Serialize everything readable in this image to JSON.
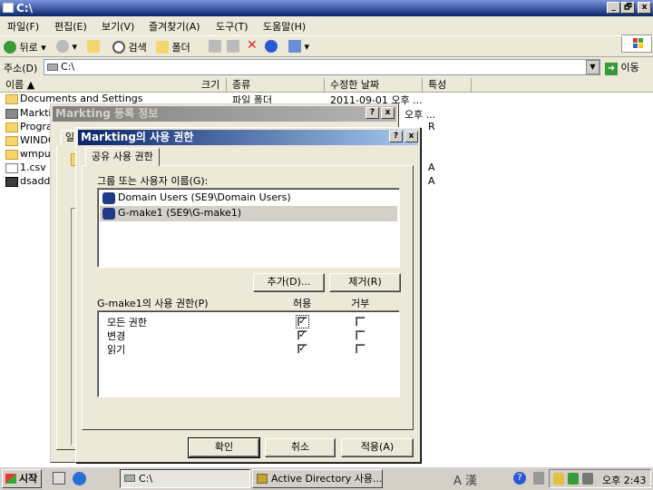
{
  "window": {
    "title": "C:\\",
    "caption_buttons": [
      "_",
      "🗗",
      "x"
    ]
  },
  "menu": [
    "파일(F)",
    "편집(E)",
    "보기(V)",
    "즐겨찾기(A)",
    "도구(T)",
    "도움말(H)"
  ],
  "toolbar": {
    "back": "뒤로",
    "search": "검색",
    "folders": "폴더"
  },
  "address": {
    "label": "주소(D)",
    "value": "C:\\",
    "go": "이동"
  },
  "columns": [
    "이름 ▲",
    "크기",
    "종류",
    "수정한 날짜",
    "특성"
  ],
  "files": [
    {
      "name": "Documents and Settings",
      "type": "파일 폴더",
      "date": "2011-09-01 오후 ...",
      "attr": ""
    },
    {
      "name": "Markti",
      "type": "",
      "date": "오후 ...",
      "attr": ""
    },
    {
      "name": "Progra",
      "type": "",
      "date": "",
      "attr": "R"
    },
    {
      "name": "WINDC",
      "type": "",
      "date": "",
      "attr": ""
    },
    {
      "name": "wmpul",
      "type": "",
      "date": "",
      "attr": ""
    },
    {
      "name": "1.csv",
      "type": "",
      "date": "",
      "attr": "A"
    },
    {
      "name": "dsadd",
      "type": "",
      "date": "",
      "attr": "A"
    }
  ],
  "prop_dialog": {
    "title": "Markting 등록 정보",
    "help": "?",
    "close": "x",
    "tab_fragment": "일"
  },
  "perm_dialog": {
    "title": "Markting의 사용 권한",
    "help": "?",
    "close": "x",
    "tab": "공유 사용 권한",
    "group_label": "그룹 또는 사용자 이름(G):",
    "users": [
      "Domain Users (SE9\\Domain Users)",
      "G-make1 (SE9\\G-make1)"
    ],
    "add_button": "추가(D)...",
    "remove_button": "제거(R)",
    "perm_label": "G-make1의 사용 권한(P)",
    "allow_header": "허용",
    "deny_header": "거부",
    "permissions": [
      {
        "name": "모든 권한",
        "allow": true,
        "deny": false
      },
      {
        "name": "변경",
        "allow": true,
        "deny": false
      },
      {
        "name": "읽기",
        "allow": true,
        "deny": false
      }
    ],
    "check_glyph": "✓",
    "ok_button": "확인",
    "cancel_button": "취소",
    "apply_button": "적용(A)"
  },
  "taskbar": {
    "start": "시작",
    "tasks": [
      "C:\\",
      "Active Directory 사용..."
    ],
    "ime": "A 漢",
    "clock": "오후 2:43"
  }
}
